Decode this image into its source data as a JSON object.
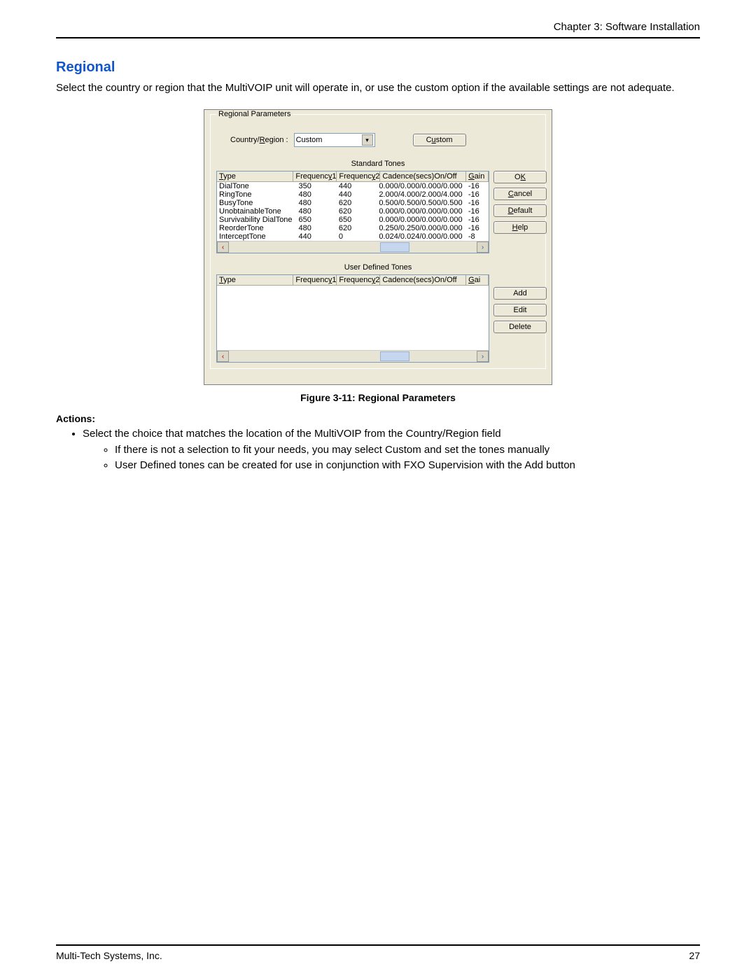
{
  "header": {
    "chapter": "Chapter 3: Software Installation"
  },
  "section": {
    "title": "Regional",
    "intro": "Select the country or region that the MultiVOIP unit will operate in, or use the custom option if the available settings are not adequate."
  },
  "dialog": {
    "groupbox_legend": "Regional Parameters",
    "country_label": "Country/",
    "country_label_u": "R",
    "country_label_tail": "egion :",
    "combo_value": "Custom",
    "custom_btn_pre": "C",
    "custom_btn_u": "u",
    "custom_btn_post": "stom",
    "std_label": "Standard Tones",
    "udt_label": "User Defined Tones",
    "headers": {
      "type_u": "T",
      "type_rest": "ype",
      "f1_pre": "Frequenc",
      "f1_u": "y",
      "f1_post": "1",
      "f2_pre": "Frequenc",
      "f2_u": "y",
      "f2_post": "2",
      "cad": "Cadence(secs)On/Off",
      "gain_u": "G",
      "gain_rest": "ain",
      "gai_u": "G",
      "gai_rest": "ai"
    },
    "std_rows": [
      {
        "type": "DialTone",
        "f1": "350",
        "f2": "440",
        "cad": "0.000/0.000/0.000/0.000",
        "g": "-16"
      },
      {
        "type": "RingTone",
        "f1": "480",
        "f2": "440",
        "cad": "2.000/4.000/2.000/4.000",
        "g": "-16"
      },
      {
        "type": "BusyTone",
        "f1": "480",
        "f2": "620",
        "cad": "0.500/0.500/0.500/0.500",
        "g": "-16"
      },
      {
        "type": "UnobtainableTone",
        "f1": "480",
        "f2": "620",
        "cad": "0.000/0.000/0.000/0.000",
        "g": "-16"
      },
      {
        "type": "Survivability DialTone",
        "f1": "650",
        "f2": "650",
        "cad": "0.000/0.000/0.000/0.000",
        "g": "-16"
      },
      {
        "type": "ReorderTone",
        "f1": "480",
        "f2": "620",
        "cad": "0.250/0.250/0.000/0.000",
        "g": "-16"
      },
      {
        "type": "InterceptTone",
        "f1": "440",
        "f2": "0",
        "cad": "0.024/0.024/0.000/0.000",
        "g": "-8"
      }
    ],
    "buttons": {
      "ok_pre": "O",
      "ok_u": "K",
      "cancel_u": "C",
      "cancel_post": "ancel",
      "default_u": "D",
      "default_post": "efault",
      "help_u": "H",
      "help_post": "elp",
      "add": "Add",
      "edit": "Edit",
      "delete": "Delete"
    }
  },
  "caption": "Figure 3-11: Regional Parameters",
  "actions": {
    "title": "Actions:",
    "b1": "Select the choice that matches the location of the MultiVOIP from the Country/Region field",
    "s1": "If there is not a selection to fit your needs, you may select Custom and set the tones manually",
    "s2": "User Defined tones can be created for use in conjunction with FXO Supervision with the Add button"
  },
  "footer": {
    "company": "Multi-Tech Systems, Inc.",
    "page": "27"
  }
}
